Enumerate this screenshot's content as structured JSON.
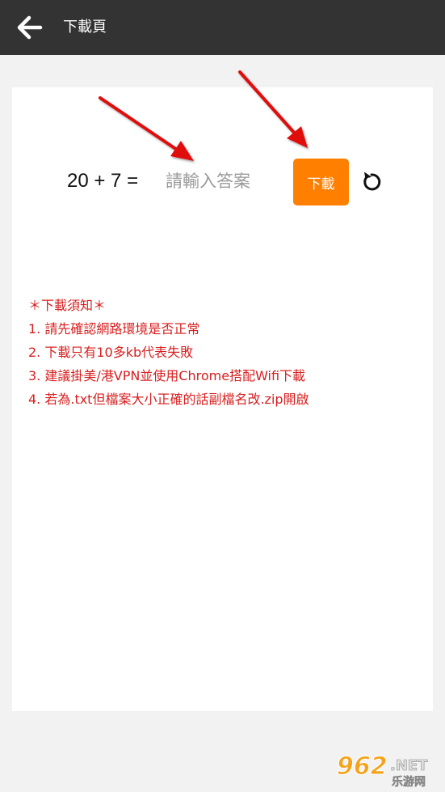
{
  "header": {
    "back_icon": "arrow-left-icon",
    "title": "下載頁"
  },
  "captcha": {
    "question": "20 + 7 =",
    "input_value": "",
    "input_placeholder": "請輸入答案",
    "download_label": "下載",
    "refresh_icon": "refresh-icon"
  },
  "notice": {
    "title": "＊下載須知＊",
    "lines": [
      "1. 請先確認網路環境是否正常",
      "2. 下載只有10多kb代表失敗",
      "3. 建議掛美/港VPN並使用Chrome搭配Wifi下載",
      "4. 若為.txt但檔案大小正確的話副檔名改.zip開啟"
    ]
  },
  "watermark": {
    "brand": "962",
    "domain": ".NET",
    "subtitle": "乐游网"
  },
  "colors": {
    "topbar": "#333333",
    "accent": "#ff7f00",
    "notice": "#d81f1f",
    "arrow": "#e01010"
  }
}
